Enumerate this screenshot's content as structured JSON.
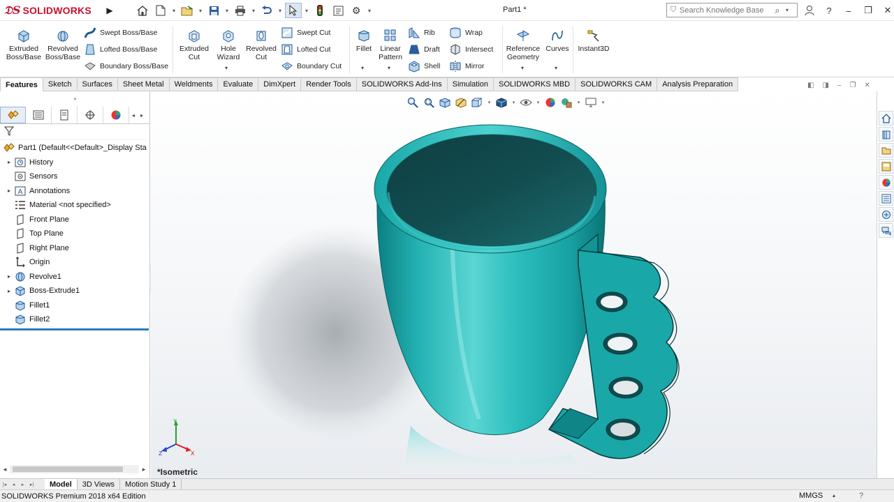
{
  "app": {
    "brand": "SOLIDWORKS",
    "document_title": "Part1 *"
  },
  "search": {
    "placeholder": "Search Knowledge Base"
  },
  "commands": {
    "extruded_boss": "Extruded Boss/Base",
    "revolved_boss": "Revolved Boss/Base",
    "swept_boss": "Swept Boss/Base",
    "lofted_boss": "Lofted Boss/Base",
    "boundary_boss": "Boundary Boss/Base",
    "extruded_cut": "Extruded Cut",
    "hole_wizard": "Hole Wizard",
    "revolved_cut": "Revolved Cut",
    "swept_cut": "Swept Cut",
    "lofted_cut": "Lofted Cut",
    "boundary_cut": "Boundary Cut",
    "fillet": "Fillet",
    "linear_pattern": "Linear Pattern",
    "rib": "Rib",
    "draft": "Draft",
    "shell": "Shell",
    "wrap": "Wrap",
    "intersect": "Intersect",
    "mirror": "Mirror",
    "reference_geometry": "Reference Geometry",
    "curves": "Curves",
    "instant3d": "Instant3D"
  },
  "tabs": [
    "Features",
    "Sketch",
    "Surfaces",
    "Sheet Metal",
    "Weldments",
    "Evaluate",
    "DimXpert",
    "Render Tools",
    "SOLIDWORKS Add-Ins",
    "Simulation",
    "SOLIDWORKS MBD",
    "SOLIDWORKS CAM",
    "Analysis Preparation"
  ],
  "tree": {
    "root": "Part1  (Default<<Default>_Display Sta",
    "items": [
      "History",
      "Sensors",
      "Annotations",
      "Material <not specified>",
      "Front Plane",
      "Top Plane",
      "Right Plane",
      "Origin",
      "Revolve1",
      "Boss-Extrude1",
      "Fillet1",
      "Fillet2"
    ]
  },
  "viewport": {
    "view_label": "*Isometric",
    "model_color": "#1fb3b3"
  },
  "bottom_tabs": [
    "Model",
    "3D Views",
    "Motion Study 1"
  ],
  "status": {
    "text": "SOLIDWORKS Premium 2018 x64 Edition",
    "units": "MMGS"
  },
  "colors": {
    "brand_red": "#c8102e",
    "accent_blue": "#1f5a9a",
    "rollback_bar": "#2a7ab8"
  },
  "triad": {
    "x": "X",
    "y": "Y",
    "z": "Z"
  }
}
